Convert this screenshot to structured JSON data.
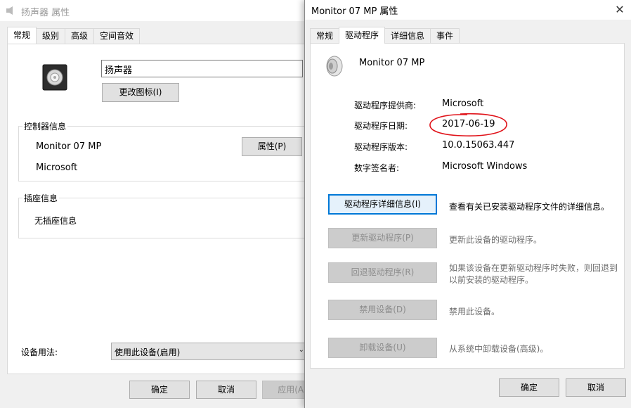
{
  "back_window": {
    "title": "扬声器 属性",
    "tabs": [
      {
        "label": "常规",
        "active": true
      },
      {
        "label": "级别"
      },
      {
        "label": "高级"
      },
      {
        "label": "空间音效"
      }
    ],
    "device_name_value": "扬声器",
    "change_icon_label": "更改图标(I)",
    "controller_group_label": "控制器信息",
    "controller_name": "Monitor 07 MP",
    "controller_vendor": "Microsoft",
    "properties_label": "属性(P)",
    "jack_group_label": "插座信息",
    "jack_value": "无插座信息",
    "usage_label": "设备用法:",
    "usage_value": "使用此设备(启用)",
    "ok_label": "确定",
    "cancel_label": "取消",
    "apply_label": "应用(A)"
  },
  "front_window": {
    "title": "Monitor 07 MP 属性",
    "tabs": [
      {
        "label": "常规"
      },
      {
        "label": "驱动程序",
        "active": true
      },
      {
        "label": "详细信息"
      },
      {
        "label": "事件"
      }
    ],
    "device_name": "Monitor 07 MP",
    "fields": [
      {
        "label": "驱动程序提供商:",
        "value": "Microsoft"
      },
      {
        "label": "驱动程序日期:",
        "value": "2017-06-19"
      },
      {
        "label": "驱动程序版本:",
        "value": "10.0.15063.447"
      },
      {
        "label": "数字签名者:",
        "value": "Microsoft Windows"
      }
    ],
    "actions": [
      {
        "label": "驱动程序详细信息(I)",
        "desc": "查看有关已安装驱动程序文件的详细信息。",
        "enabled": true
      },
      {
        "label": "更新驱动程序(P)",
        "desc": "更新此设备的驱动程序。",
        "enabled": false
      },
      {
        "label": "回退驱动程序(R)",
        "desc_line1": "如果该设备在更新驱动程序时失败，则回退到",
        "desc_line2": "以前安装的驱动程序。",
        "enabled": false
      },
      {
        "label": "禁用设备(D)",
        "desc": "禁用此设备。",
        "enabled": false
      },
      {
        "label": "卸载设备(U)",
        "desc": "从系统中卸载设备(高级)。",
        "enabled": false
      }
    ],
    "ok_label": "确定",
    "cancel_label": "取消",
    "annotation_color": "#e0131a"
  }
}
